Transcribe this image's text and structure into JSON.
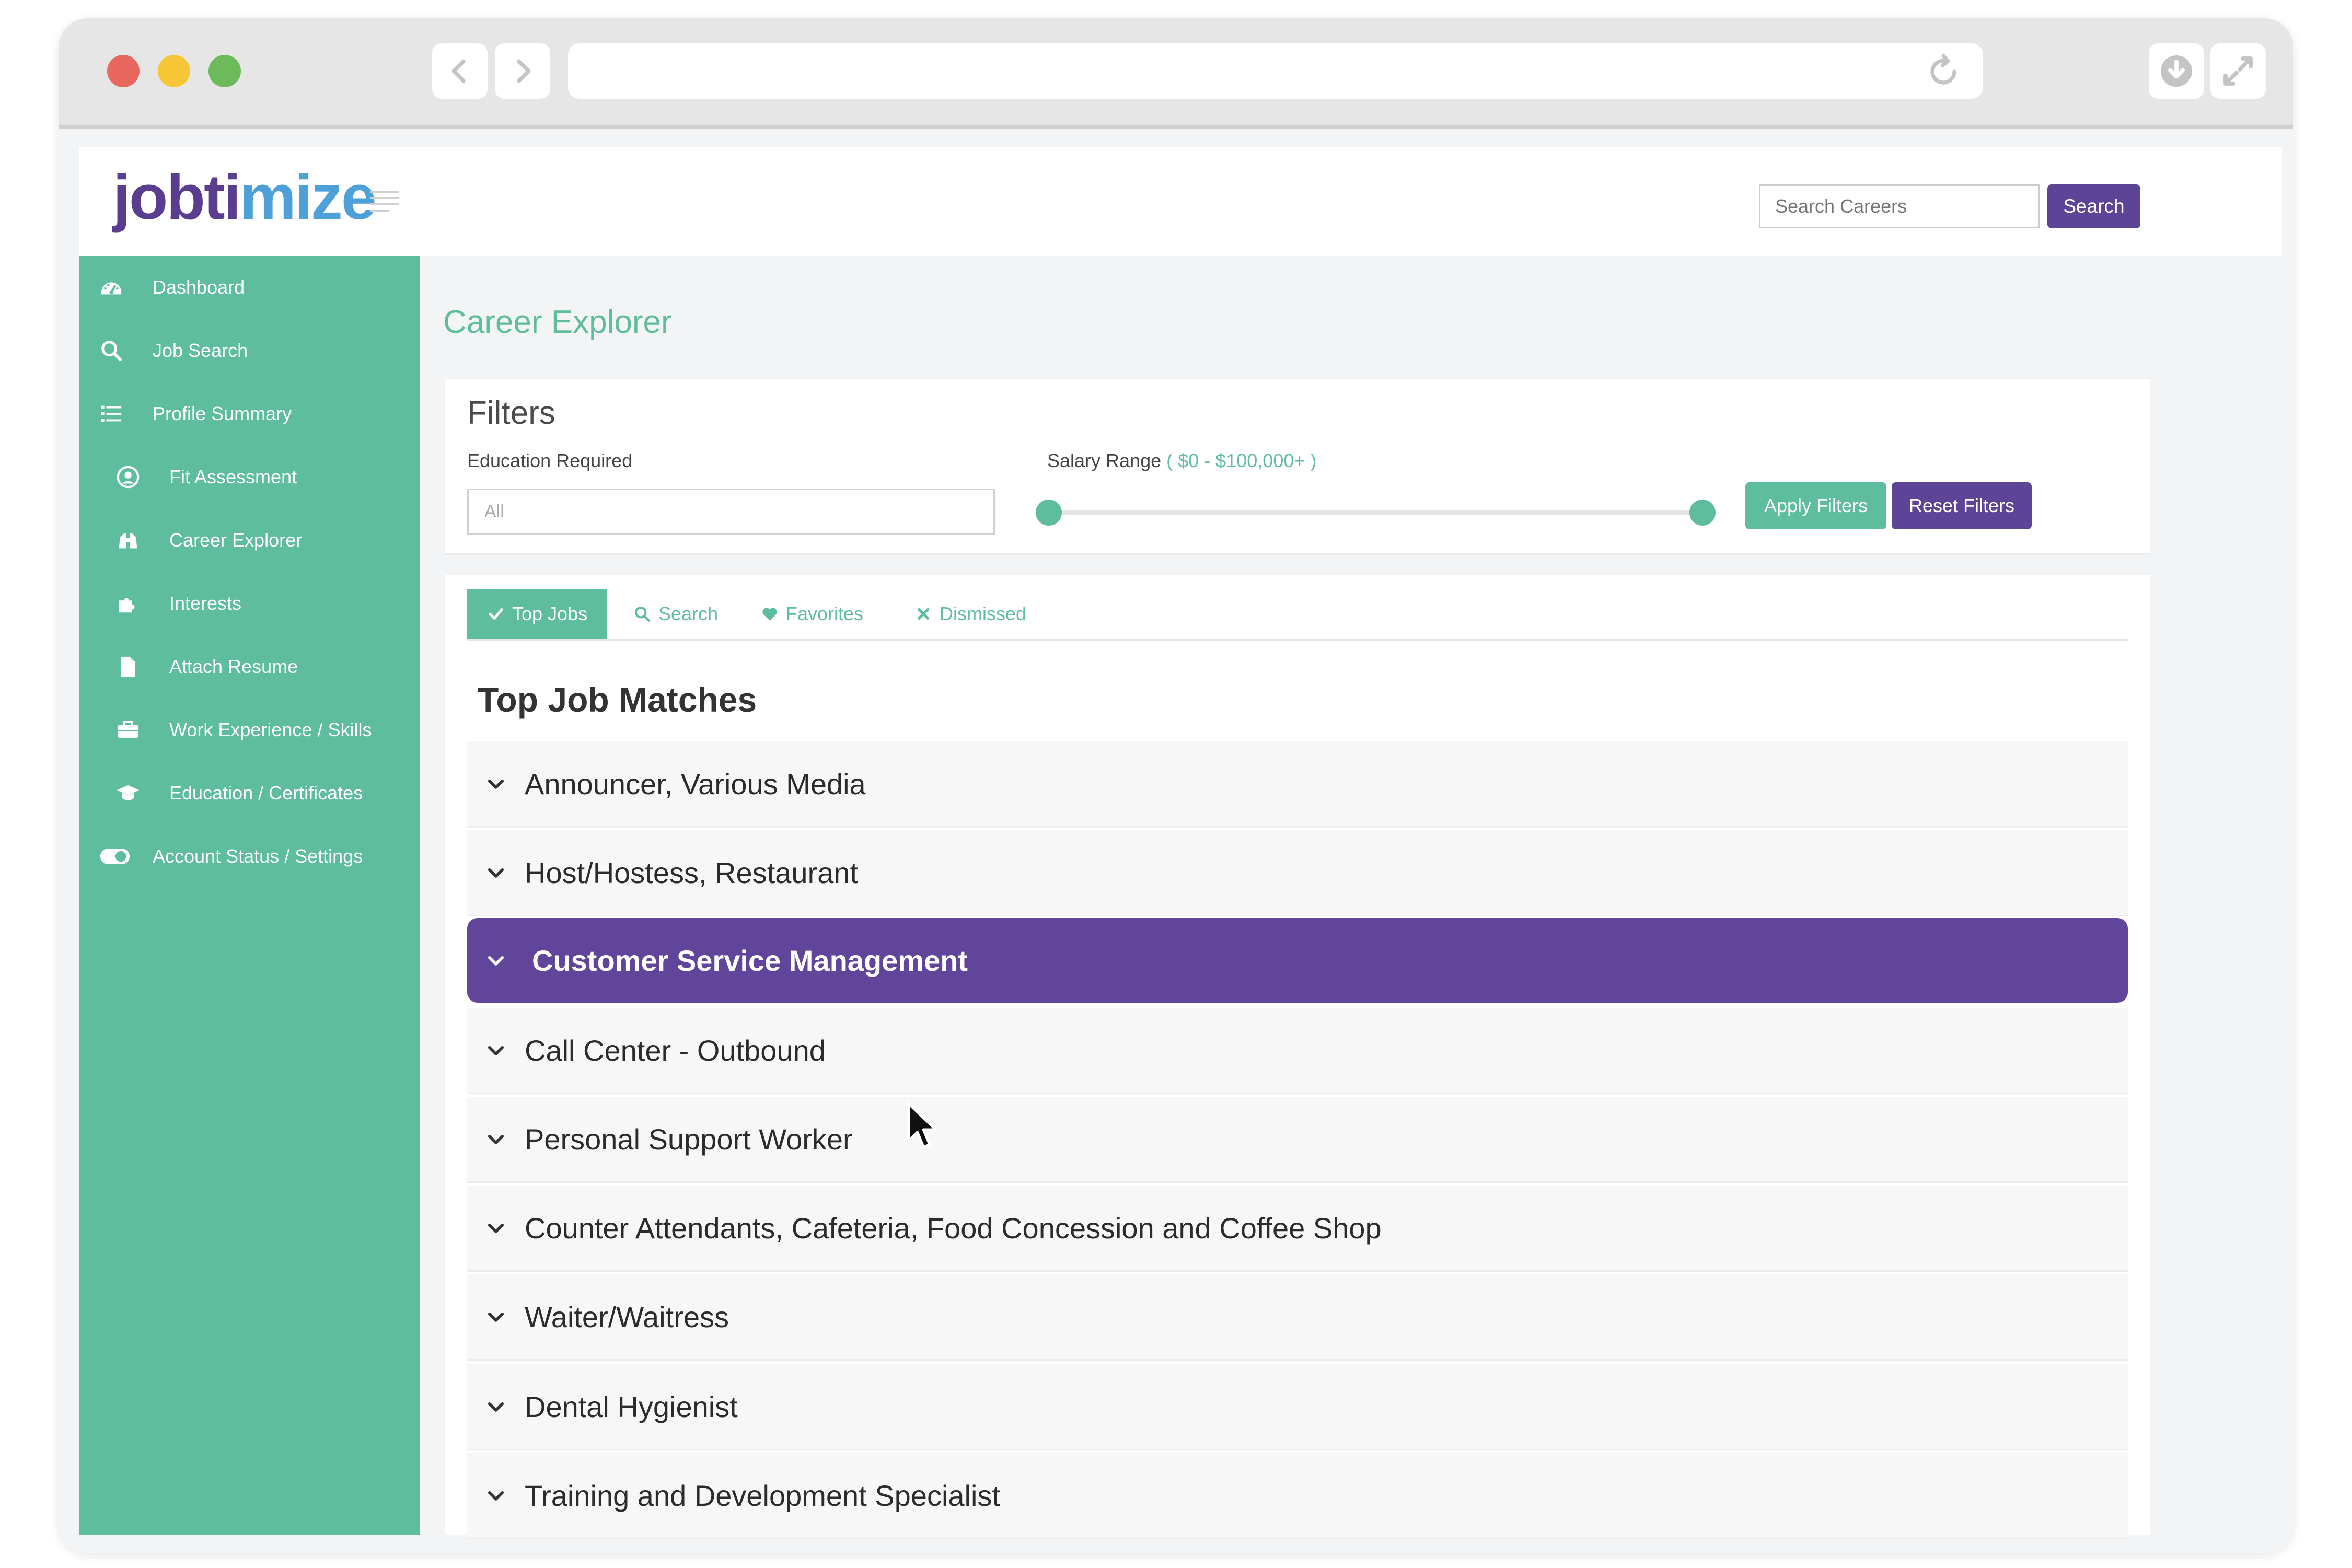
{
  "browser": {
    "url": ""
  },
  "header": {
    "logo_part1": "jobti",
    "logo_part2": "mize",
    "search_placeholder": "Search Careers",
    "search_button": "Search"
  },
  "sidebar": {
    "items": [
      {
        "label": "Dashboard",
        "icon": "dashboard-icon",
        "level": "top"
      },
      {
        "label": "Job Search",
        "icon": "search-icon",
        "level": "top"
      },
      {
        "label": "Profile Summary",
        "icon": "list-icon",
        "level": "top"
      },
      {
        "label": "Fit Assessment",
        "icon": "user-circle-icon",
        "level": "sub"
      },
      {
        "label": "Career Explorer",
        "icon": "binoculars-icon",
        "level": "sub"
      },
      {
        "label": "Interests",
        "icon": "puzzle-icon",
        "level": "sub"
      },
      {
        "label": "Attach Resume",
        "icon": "file-icon",
        "level": "sub"
      },
      {
        "label": "Work Experience / Skills",
        "icon": "briefcase-icon",
        "level": "sub"
      },
      {
        "label": "Education / Certificates",
        "icon": "graduation-cap-icon",
        "level": "sub"
      },
      {
        "label": "Account Status / Settings",
        "icon": "toggle-icon",
        "level": "top"
      }
    ]
  },
  "main": {
    "title": "Career Explorer",
    "filters": {
      "title": "Filters",
      "education_label": "Education Required",
      "education_value": "All",
      "salary_label": "Salary Range",
      "salary_range": "( $0 - $100,000+ )",
      "salary_min_fraction": 0,
      "salary_max_fraction": 1,
      "apply_label": "Apply Filters",
      "reset_label": "Reset Filters"
    },
    "tabs": [
      {
        "label": "Top Jobs",
        "icon": "check-icon",
        "active": true
      },
      {
        "label": "Search",
        "icon": "search-icon",
        "active": false
      },
      {
        "label": "Favorites",
        "icon": "heart-icon",
        "active": false
      },
      {
        "label": "Dismissed",
        "icon": "close-icon",
        "active": false
      }
    ],
    "section_title": "Top Job Matches",
    "jobs": [
      {
        "title": "Announcer, Various Media",
        "active": false
      },
      {
        "title": "Host/Hostess, Restaurant",
        "active": false
      },
      {
        "title": "Customer Service Management",
        "active": true
      },
      {
        "title": "Call Center - Outbound",
        "active": false
      },
      {
        "title": "Personal Support Worker",
        "active": false
      },
      {
        "title": "Counter Attendants, Cafeteria, Food Concession and Coffee Shop",
        "active": false
      },
      {
        "title": "Waiter/Waitress",
        "active": false
      },
      {
        "title": "Dental Hygienist",
        "active": false
      },
      {
        "title": "Training and Development Specialist",
        "active": false
      }
    ]
  },
  "colors": {
    "accent_green": "#5ebd9c",
    "accent_purple": "#5d4497",
    "active_row": "#61459a"
  }
}
